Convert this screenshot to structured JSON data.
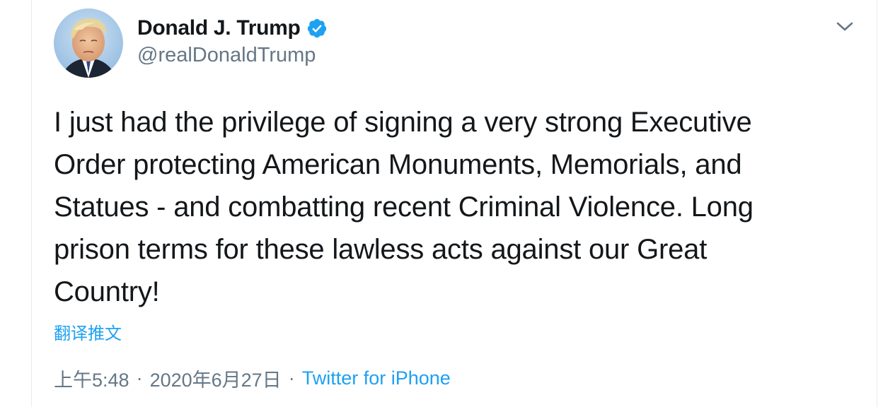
{
  "author": {
    "display_name": "Donald J. Trump",
    "handle": "@realDonaldTrump",
    "verified": true,
    "avatar": "profile-photo"
  },
  "tweet": {
    "text": "I just had the privilege of signing a very strong Executive Order protecting American Monuments, Memorials, and Statues - and combatting recent Criminal Violence. Long prison terms for these lawless acts against our Great Country!",
    "lines": [
      "I just had the privilege of signing a very strong Executive",
      "Order protecting American Monuments, Memorials, and",
      "Statues - and combatting recent Criminal Violence. Long",
      "prison terms for these lawless acts against our Great",
      "Country!"
    ],
    "translate_label": "翻译推文"
  },
  "meta": {
    "time": "上午5:48",
    "separator": "·",
    "date": "2020年6月27日",
    "source": "Twitter for iPhone"
  },
  "icons": {
    "verified": "verified-badge-icon",
    "menu": "chevron-down-icon"
  },
  "colors": {
    "accent": "#1da1f2",
    "text": "#14171a",
    "secondary": "#657786",
    "border": "#e6ecf0"
  }
}
